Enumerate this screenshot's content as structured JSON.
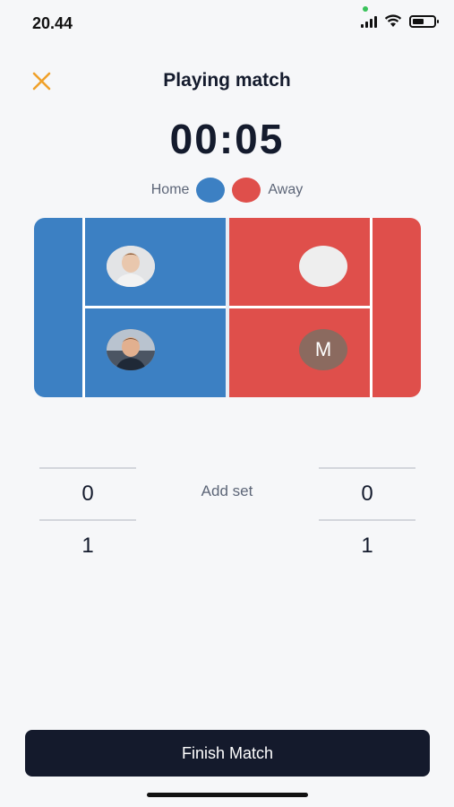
{
  "status_bar": {
    "time": "20.44",
    "battery_level": 0.55
  },
  "header": {
    "title": "Playing match",
    "close_icon": "close-x-icon",
    "close_color": "#f0a12a"
  },
  "timer": {
    "value": "00:05"
  },
  "legend": {
    "home_label": "Home",
    "away_label": "Away",
    "home_color": "#3c80c3",
    "away_color": "#df4f4b"
  },
  "court": {
    "home_players": [
      {
        "type": "photo",
        "name": "home-player-1-avatar"
      },
      {
        "type": "photo",
        "name": "home-player-2-avatar"
      }
    ],
    "away_players": [
      {
        "type": "blank",
        "name": "away-player-1-avatar"
      },
      {
        "type": "initial",
        "initial": "M",
        "name": "away-player-2-avatar"
      }
    ]
  },
  "scores": {
    "home": [
      "0",
      "1"
    ],
    "away": [
      "0",
      "1"
    ],
    "add_set_label": "Add set"
  },
  "footer": {
    "finish_label": "Finish Match"
  }
}
